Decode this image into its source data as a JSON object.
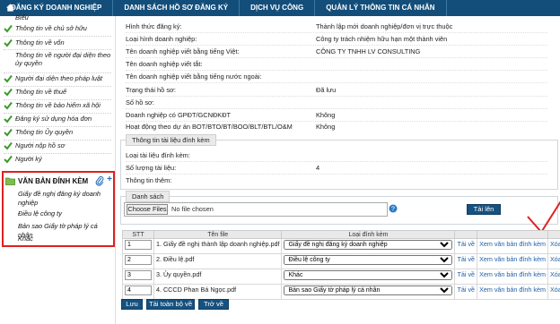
{
  "nav": {
    "items": [
      "ĐĂNG KÝ DOANH NGHIỆP",
      "DANH SÁCH HỒ SƠ ĐĂNG KÝ",
      "DỊCH VỤ CÔNG",
      "QUẢN LÝ THÔNG TIN CÁ NHÂN"
    ]
  },
  "sidebar": {
    "partial_top": "Biểu",
    "items": [
      "Thông tin về chủ sở hữu",
      "Thông tin về vốn",
      "Thông tin về người đại diện theo ủy quyền",
      "Người đại diện theo pháp luật",
      "Thông tin về thuế",
      "Thông tin về bảo hiểm xã hội",
      "Đăng ký sử dụng hóa đơn",
      "Thông tin Ủy quyền",
      "Người nộp hồ sơ",
      "Người ký"
    ],
    "attachments_title": "VĂN BẢN ĐÍNH KÈM",
    "attachments": [
      "Giấy đề nghị đăng ký doanh nghiệp",
      "Điều lệ công ty",
      "Bản sao Giấy tờ pháp lý cá nhân",
      "Khác"
    ]
  },
  "info": {
    "rows": [
      {
        "k": "Hình thức đăng ký:",
        "v": "Thành lập mới doanh nghiệp/đơn vị trực thuộc"
      },
      {
        "k": "Loại hình doanh nghiệp:",
        "v": "Công ty trách nhiệm hữu hạn một thành viên"
      },
      {
        "k": "Tên doanh nghiệp viết bằng tiếng Việt:",
        "v": "CÔNG TY TNHH LV CONSULTING"
      },
      {
        "k": "Tên doanh nghiệp viết tắt:",
        "v": ""
      },
      {
        "k": "Tên doanh nghiệp viết bằng tiếng nước ngoài:",
        "v": ""
      },
      {
        "k": "Trạng thái hồ sơ:",
        "v": "Đã lưu"
      },
      {
        "k": "Số hồ sơ:",
        "v": ""
      },
      {
        "k": "Doanh nghiệp có GPĐT/GCNĐKĐT",
        "v": "Không"
      },
      {
        "k": "Hoạt động theo dự án BOT/BTO/BT/BOO/BLT/BTL/O&M",
        "v": "Không"
      }
    ]
  },
  "attach_info": {
    "legend": "Thông tin tài liệu đính kèm",
    "rows": [
      {
        "k": "Loại tài liệu đính kèm:",
        "v": ""
      },
      {
        "k": "Số lượng tài liệu:",
        "v": "4"
      },
      {
        "k": "Thông tin thêm:",
        "v": ""
      }
    ]
  },
  "upload": {
    "legend": "Danh sách",
    "choose_label": "Choose Files",
    "no_file": "No file chosen",
    "upload_label": "Tải lên"
  },
  "table": {
    "headers": [
      "STT",
      "Tên file",
      "Loại đính kèm",
      "",
      "",
      ""
    ],
    "rows": [
      {
        "stt": "1",
        "file": "1. Giấy đề nghị thành lập doanh nghiệp.pdf",
        "type": "Giấy đề nghị đăng ký doanh nghiệp",
        "a1": "Tải về",
        "a2": "Xem văn bản đính kèm",
        "a3": "Xóa"
      },
      {
        "stt": "2",
        "file": "2. Điều lệ.pdf",
        "type": "Điều lệ công ty",
        "a1": "Tải về",
        "a2": "Xem văn bản đính kèm",
        "a3": "Xóa"
      },
      {
        "stt": "3",
        "file": "3. Ủy quyền.pdf",
        "type": "Khác",
        "a1": "Tải về",
        "a2": "Xem văn bản đính kèm",
        "a3": "Xóa"
      },
      {
        "stt": "4",
        "file": "4. CCCD Phan Bá Ngọc.pdf",
        "type": "Bản sao Giấy tờ pháp lý cá nhân",
        "a1": "Tải về",
        "a2": "Xem văn bản đính kèm",
        "a3": "Xóa"
      }
    ]
  },
  "buttons": {
    "save": "Lưu",
    "download_all": "Tải toàn bộ về",
    "back": "Trở về"
  },
  "colors": {
    "nav_bg": "#134e7a",
    "accent_blue": "#16517f",
    "highlight_red": "#e02020",
    "check_green": "#3a9a2a"
  }
}
